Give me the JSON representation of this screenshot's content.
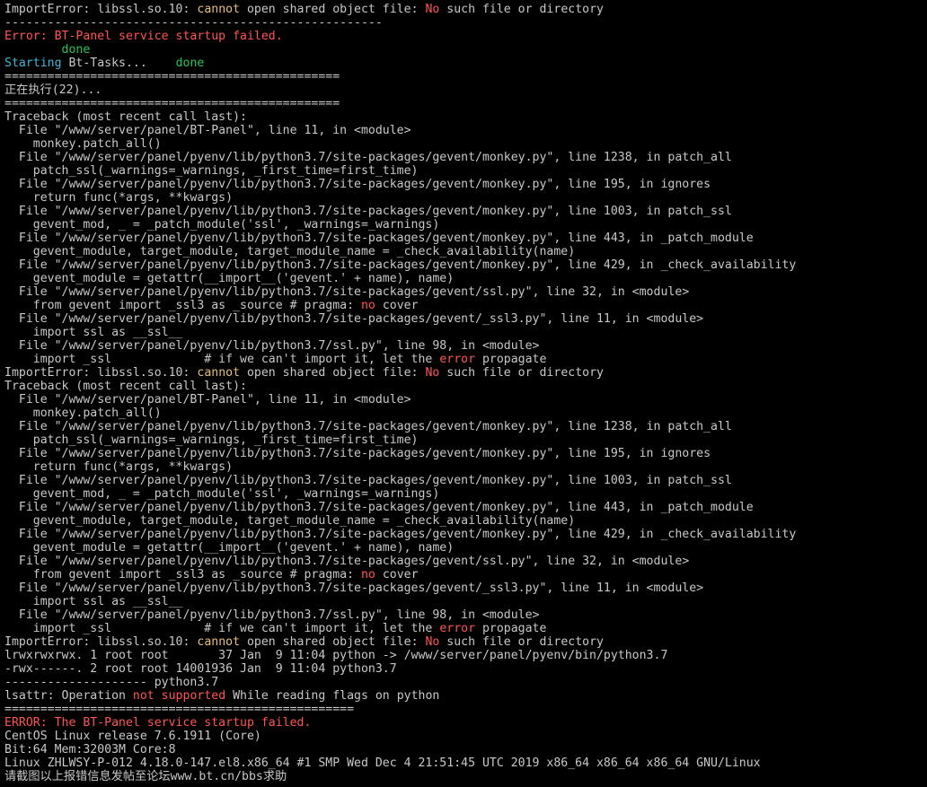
{
  "terminal": {
    "colors": {
      "background": "#000000",
      "default": "#c8c8c8",
      "red": "#ff5555",
      "yellow": "#e5c07b",
      "green": "#23c45e",
      "cyan": "#3fb8d8"
    },
    "lines": [
      [
        {
          "t": "ImportError: libssl.so.10: "
        },
        {
          "t": "cannot",
          "c": "yellow"
        },
        {
          "t": " open shared object file: "
        },
        {
          "t": "No",
          "c": "red"
        },
        {
          "t": " such file or directory"
        }
      ],
      [
        {
          "t": "-----------------------------------------------------"
        }
      ],
      [
        {
          "t": "Error: BT-Panel service startup failed.",
          "c": "red"
        }
      ],
      [
        {
          "t": "        "
        },
        {
          "t": "done",
          "c": "green"
        }
      ],
      [
        {
          "t": "Starting",
          "c": "cyan"
        },
        {
          "t": " Bt-Tasks...    "
        },
        {
          "t": "done",
          "c": "green"
        }
      ],
      [
        {
          "t": "==============================================="
        }
      ],
      [
        {
          "t": "正在执行(22)..."
        }
      ],
      [
        {
          "t": "==============================================="
        }
      ],
      [
        {
          "t": "Traceback (most recent call last):"
        }
      ],
      [
        {
          "t": "  File \"/www/server/panel/BT-Panel\", line 11, in <module>"
        }
      ],
      [
        {
          "t": "    monkey.patch_all()"
        }
      ],
      [
        {
          "t": "  File \"/www/server/panel/pyenv/lib/python3.7/site-packages/gevent/monkey.py\", line 1238, in patch_all"
        }
      ],
      [
        {
          "t": "    patch_ssl(_warnings=_warnings, _first_time=first_time)"
        }
      ],
      [
        {
          "t": "  File \"/www/server/panel/pyenv/lib/python3.7/site-packages/gevent/monkey.py\", line 195, in ignores"
        }
      ],
      [
        {
          "t": "    return func(*args, **kwargs)"
        }
      ],
      [
        {
          "t": "  File \"/www/server/panel/pyenv/lib/python3.7/site-packages/gevent/monkey.py\", line 1003, in patch_ssl"
        }
      ],
      [
        {
          "t": "    gevent_mod, _ = _patch_module('ssl', _warnings=_warnings)"
        }
      ],
      [
        {
          "t": "  File \"/www/server/panel/pyenv/lib/python3.7/site-packages/gevent/monkey.py\", line 443, in _patch_module"
        }
      ],
      [
        {
          "t": "    gevent_module, target_module, target_module_name = _check_availability(name)"
        }
      ],
      [
        {
          "t": "  File \"/www/server/panel/pyenv/lib/python3.7/site-packages/gevent/monkey.py\", line 429, in _check_availability"
        }
      ],
      [
        {
          "t": "    gevent_module = getattr(__import__('gevent.' + name), name)"
        }
      ],
      [
        {
          "t": "  File \"/www/server/panel/pyenv/lib/python3.7/site-packages/gevent/ssl.py\", line 32, in <module>"
        }
      ],
      [
        {
          "t": "    from gevent import _ssl3 as _source # pragma: "
        },
        {
          "t": "no",
          "c": "red"
        },
        {
          "t": " cover"
        }
      ],
      [
        {
          "t": "  File \"/www/server/panel/pyenv/lib/python3.7/site-packages/gevent/_ssl3.py\", line 11, in <module>"
        }
      ],
      [
        {
          "t": "    import ssl as __ssl__"
        }
      ],
      [
        {
          "t": "  File \"/www/server/panel/pyenv/lib/python3.7/ssl.py\", line 98, in <module>"
        }
      ],
      [
        {
          "t": "    import _ssl             # if we can't import it, let the "
        },
        {
          "t": "error",
          "c": "red"
        },
        {
          "t": " propagate"
        }
      ],
      [
        {
          "t": "ImportError: libssl.so.10: "
        },
        {
          "t": "cannot",
          "c": "yellow"
        },
        {
          "t": " open shared object file: "
        },
        {
          "t": "No",
          "c": "red"
        },
        {
          "t": " such file or directory"
        }
      ],
      [
        {
          "t": "Traceback (most recent call last):"
        }
      ],
      [
        {
          "t": "  File \"/www/server/panel/BT-Panel\", line 11, in <module>"
        }
      ],
      [
        {
          "t": "    monkey.patch_all()"
        }
      ],
      [
        {
          "t": "  File \"/www/server/panel/pyenv/lib/python3.7/site-packages/gevent/monkey.py\", line 1238, in patch_all"
        }
      ],
      [
        {
          "t": "    patch_ssl(_warnings=_warnings, _first_time=first_time)"
        }
      ],
      [
        {
          "t": "  File \"/www/server/panel/pyenv/lib/python3.7/site-packages/gevent/monkey.py\", line 195, in ignores"
        }
      ],
      [
        {
          "t": "    return func(*args, **kwargs)"
        }
      ],
      [
        {
          "t": "  File \"/www/server/panel/pyenv/lib/python3.7/site-packages/gevent/monkey.py\", line 1003, in patch_ssl"
        }
      ],
      [
        {
          "t": "    gevent_mod, _ = _patch_module('ssl', _warnings=_warnings)"
        }
      ],
      [
        {
          "t": "  File \"/www/server/panel/pyenv/lib/python3.7/site-packages/gevent/monkey.py\", line 443, in _patch_module"
        }
      ],
      [
        {
          "t": "    gevent_module, target_module, target_module_name = _check_availability(name)"
        }
      ],
      [
        {
          "t": "  File \"/www/server/panel/pyenv/lib/python3.7/site-packages/gevent/monkey.py\", line 429, in _check_availability"
        }
      ],
      [
        {
          "t": "    gevent_module = getattr(__import__('gevent.' + name), name)"
        }
      ],
      [
        {
          "t": "  File \"/www/server/panel/pyenv/lib/python3.7/site-packages/gevent/ssl.py\", line 32, in <module>"
        }
      ],
      [
        {
          "t": "    from gevent import _ssl3 as _source # pragma: "
        },
        {
          "t": "no",
          "c": "red"
        },
        {
          "t": " cover"
        }
      ],
      [
        {
          "t": "  File \"/www/server/panel/pyenv/lib/python3.7/site-packages/gevent/_ssl3.py\", line 11, in <module>"
        }
      ],
      [
        {
          "t": "    import ssl as __ssl__"
        }
      ],
      [
        {
          "t": "  File \"/www/server/panel/pyenv/lib/python3.7/ssl.py\", line 98, in <module>"
        }
      ],
      [
        {
          "t": "    import _ssl             # if we can't import it, let the "
        },
        {
          "t": "error",
          "c": "red"
        },
        {
          "t": " propagate"
        }
      ],
      [
        {
          "t": "ImportError: libssl.so.10: "
        },
        {
          "t": "cannot",
          "c": "yellow"
        },
        {
          "t": " open shared object file: "
        },
        {
          "t": "No",
          "c": "red"
        },
        {
          "t": " such file or directory"
        }
      ],
      [
        {
          "t": "lrwxrwxrwx. 1 root root       37 Jan  9 11:04 python -> /www/server/panel/pyenv/bin/python3.7"
        }
      ],
      [
        {
          "t": "-rwx------. 2 root root 14001936 Jan  9 11:04 python3.7"
        }
      ],
      [
        {
          "t": "-------------------- python3.7"
        }
      ],
      [
        {
          "t": "lsattr: Operation "
        },
        {
          "t": "not supported",
          "c": "red"
        },
        {
          "t": " While reading flags on python"
        }
      ],
      [
        {
          "t": "================================================="
        }
      ],
      [
        {
          "t": "ERROR: The BT-Panel service startup failed.",
          "c": "red"
        }
      ],
      [
        {
          "t": "CentOS Linux release 7.6.1911 (Core)"
        }
      ],
      [
        {
          "t": "Bit:64 Mem:32003M Core:8"
        }
      ],
      [
        {
          "t": "Linux ZHLWSY-P-012 4.18.0-147.el8.x86_64 #1 SMP Wed Dec 4 21:51:45 UTC 2019 x86_64 x86_64 x86_64 GNU/Linux"
        }
      ],
      [
        {
          "t": "请截图以上报错信息发帖至论坛www.bt.cn/bbs求助"
        }
      ]
    ]
  }
}
